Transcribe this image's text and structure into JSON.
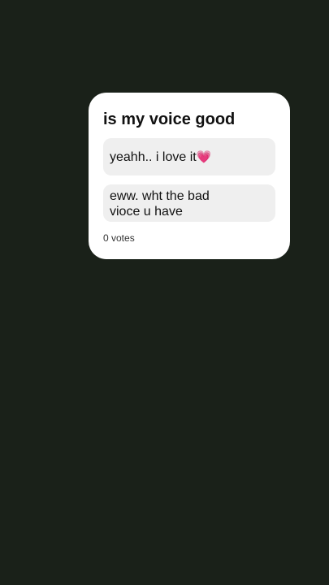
{
  "poll": {
    "question": "is my voice good",
    "options": [
      {
        "text": "yeahh.. i love it",
        "emoji": "💗"
      },
      {
        "text": "eww. wht the bad vioce u have",
        "emoji": ""
      }
    ],
    "votes_label": "0 votes"
  },
  "colors": {
    "background": "#1a2119",
    "card": "#ffffff",
    "option_bg": "#efefef",
    "heart": "#e0357a"
  }
}
